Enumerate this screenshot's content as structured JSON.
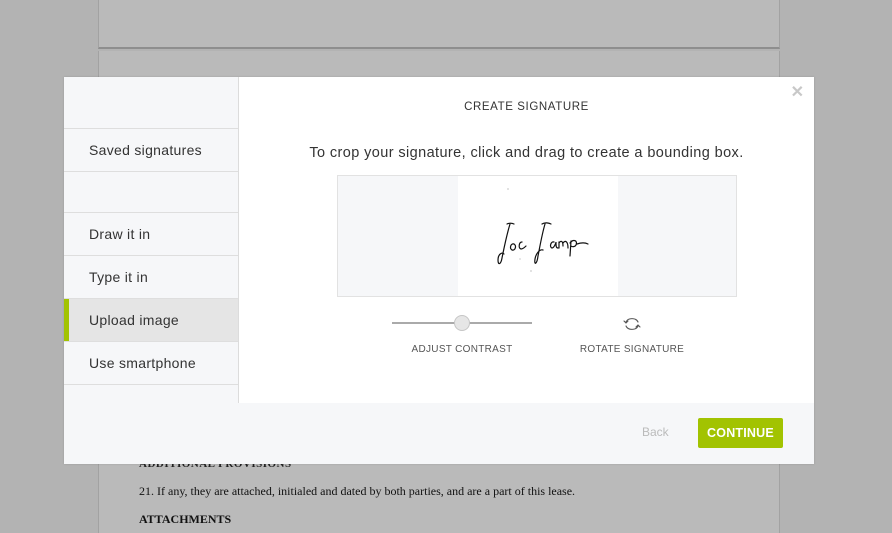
{
  "document": {
    "cut_heading": "ADDITIONAL PROVISIONS",
    "paragraph": "21.  If any, they are attached, initialed and dated by both parties, and are a part of this lease.",
    "heading": "ATTACHMENTS"
  },
  "modal": {
    "title": "CREATE SIGNATURE",
    "instruction": "To crop your signature, click and drag to create a bounding box.",
    "close_icon": "close-icon",
    "sidebar": {
      "items": [
        {
          "label": "Saved signatures",
          "active": false
        },
        {
          "label": "Draw it in",
          "active": false
        },
        {
          "label": "Type it in",
          "active": false
        },
        {
          "label": "Upload image",
          "active": true
        },
        {
          "label": "Use smartphone",
          "active": false
        }
      ]
    },
    "signature_text": "Joe Lamp",
    "controls": {
      "contrast_label": "ADJUST CONTRAST",
      "contrast_value": 0.5,
      "rotate_label": "ROTATE SIGNATURE",
      "rotate_icon": "rotate-icon"
    },
    "footer": {
      "back_label": "Back",
      "continue_label": "CONTINUE"
    }
  },
  "colors": {
    "accent": "#a2c301",
    "overlay": "#b3b3b3",
    "panel": "#f6f7f9"
  }
}
